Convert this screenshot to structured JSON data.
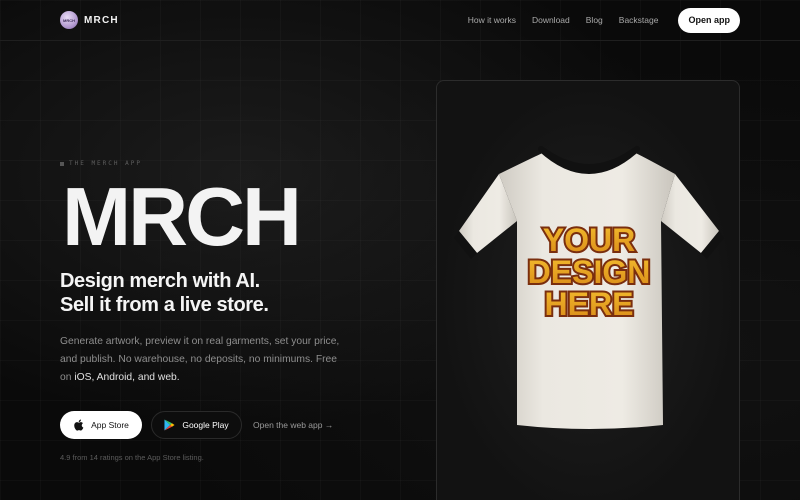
{
  "nav": {
    "brand": "MRCH",
    "logo_text": "MRCH",
    "links": [
      "How it works",
      "Download",
      "Blog",
      "Backstage"
    ],
    "cta": "Open app"
  },
  "hero": {
    "eyebrow": "THE MERCH APP",
    "title": "MRCH",
    "headline_line1": "Design merch with AI.",
    "headline_line2": "Sell it from a live store.",
    "description": "Generate artwork, preview it on real garments, set your price, and publish. No warehouse, no deposits, no minimums. Free on ",
    "description_highlight": "iOS, Android, and web.",
    "app_store_label": "App Store",
    "google_play_label": "Google Play",
    "web_link": "Open the web app →",
    "ratings": "4.9 from 14 ratings on the App Store listing."
  },
  "mockup": {
    "design_lines": [
      "YOUR",
      "DESIGN",
      "HERE"
    ],
    "shirt_color": "#e9e6df",
    "trim_color": "#111111",
    "design_fill": "#e8a521",
    "design_outline": "#7a2e0e"
  },
  "colors": {
    "accent": "#ffffff",
    "background": "#0b0b0b"
  },
  "icons": {
    "app_store": "apple-icon",
    "google_play": "google-play-icon"
  }
}
